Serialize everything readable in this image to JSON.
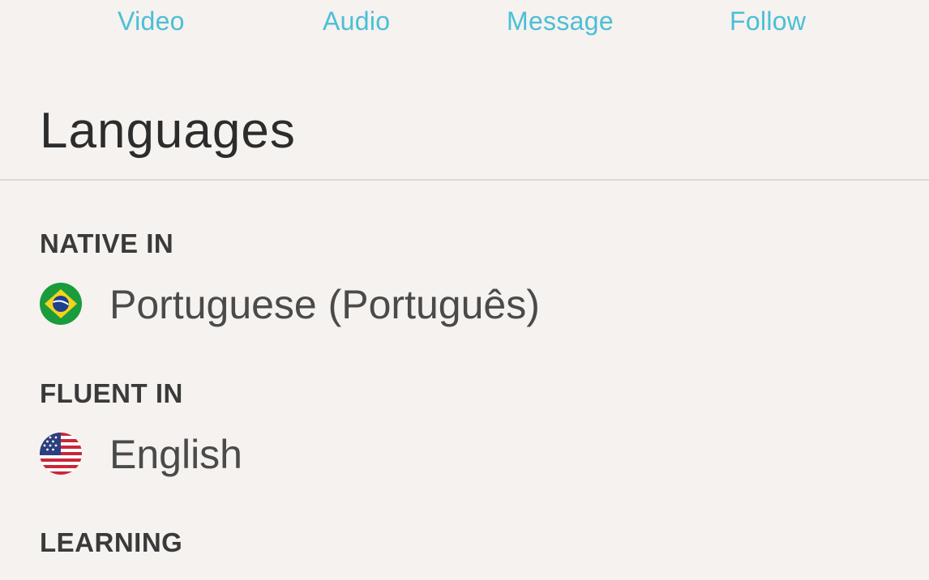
{
  "actions": {
    "video": "Video",
    "audio": "Audio",
    "message": "Message",
    "follow": "Follow"
  },
  "languages": {
    "title": "Languages",
    "native_label": "NATIVE IN",
    "native": [
      {
        "name": "Portuguese (Português)",
        "flag": "brazil-flag-icon"
      }
    ],
    "fluent_label": "FLUENT IN",
    "fluent": [
      {
        "name": "English",
        "flag": "usa-flag-icon"
      }
    ],
    "learning_label": "LEARNING"
  },
  "colors": {
    "background": "#f5f2ef",
    "accent": "#4bbfd6",
    "text": "#2f2f2f",
    "divider": "#dcd9d6"
  }
}
